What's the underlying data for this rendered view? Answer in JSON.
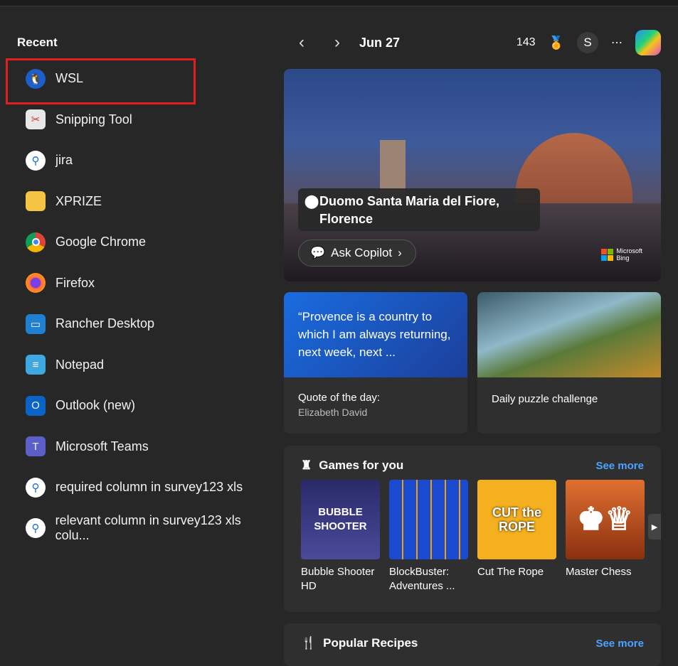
{
  "sidebar": {
    "title": "Recent",
    "items": [
      {
        "label": "WSL",
        "icon": "penguin-icon"
      },
      {
        "label": "Snipping Tool",
        "icon": "scissors-icon"
      },
      {
        "label": "jira",
        "icon": "search-icon"
      },
      {
        "label": "XPRIZE",
        "icon": "folder-icon"
      },
      {
        "label": "Google Chrome",
        "icon": "chrome-icon"
      },
      {
        "label": "Firefox",
        "icon": "firefox-icon"
      },
      {
        "label": "Rancher Desktop",
        "icon": "rancher-icon"
      },
      {
        "label": "Notepad",
        "icon": "notepad-icon"
      },
      {
        "label": "Outlook (new)",
        "icon": "outlook-icon"
      },
      {
        "label": "Microsoft Teams",
        "icon": "teams-icon"
      },
      {
        "label": "required column in survey123 xls",
        "icon": "search-icon"
      },
      {
        "label": "relevant column in survey123 xls colu...",
        "icon": "search-icon"
      }
    ]
  },
  "header": {
    "date": "Jun 27",
    "points": "143",
    "avatar": "S",
    "more": "⋯"
  },
  "hero": {
    "location": "Duomo Santa Maria del Fiore, Florence",
    "ask": "Ask Copilot",
    "brand1": "Microsoft",
    "brand2": "Bing"
  },
  "quote": {
    "text": "“Provence is a country to which I am always returning, next week, next ...",
    "label": "Quote of the day:",
    "author": "Elizabeth David"
  },
  "puzzle": {
    "label": "Daily puzzle challenge"
  },
  "games": {
    "title": "Games for you",
    "see_more": "See more",
    "items": [
      {
        "name": "Bubble Shooter HD",
        "art": "BUBBLE SHOOTER"
      },
      {
        "name": "BlockBuster: Adventures ...",
        "art": ""
      },
      {
        "name": "Cut The Rope",
        "art": "CUT the ROPE"
      },
      {
        "name": "Master Chess",
        "art": "♚♕"
      }
    ]
  },
  "recipes": {
    "title": "Popular Recipes",
    "see_more": "See more"
  },
  "colors": {
    "accent": "#4ca3ff",
    "selection": "#e02020"
  }
}
